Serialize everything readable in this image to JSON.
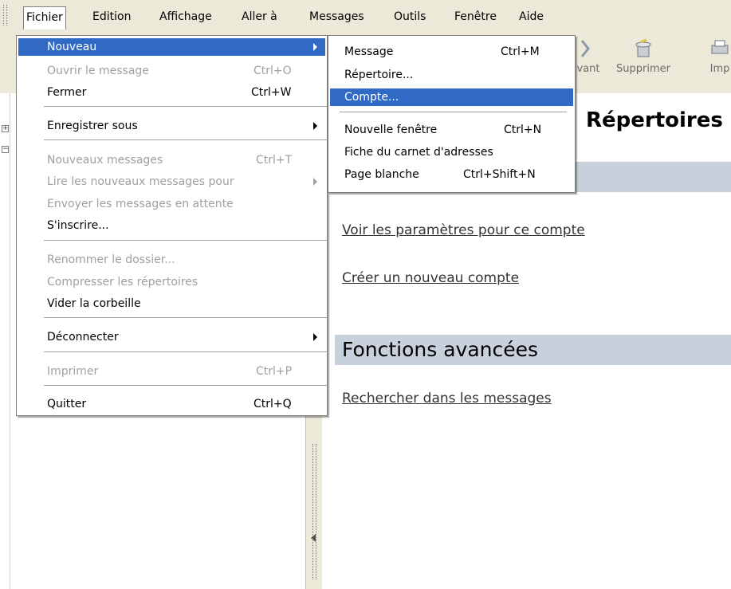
{
  "menubar": {
    "items": [
      "Fichier",
      "Edition",
      "Affichage",
      "Aller à",
      "Messages",
      "Outils",
      "Fenêtre",
      "Aide"
    ]
  },
  "toolbar": {
    "buttons": [
      {
        "label": "vant",
        "icon": "next-icon"
      },
      {
        "label": "Supprimer",
        "icon": "trash-icon"
      },
      {
        "label": "Imp",
        "icon": "print-icon"
      }
    ]
  },
  "fichier_menu": {
    "items": [
      {
        "label": "Nouveau",
        "shortcut": "",
        "submenu": true,
        "disabled": false,
        "highlighted": true
      },
      {
        "label": "Ouvrir le message",
        "shortcut": "Ctrl+O",
        "submenu": false,
        "disabled": true
      },
      {
        "label": "Fermer",
        "shortcut": "Ctrl+W",
        "submenu": false,
        "disabled": false
      },
      {
        "label": "Enregistrer sous",
        "shortcut": "",
        "submenu": true,
        "disabled": false
      },
      {
        "label": "Nouveaux messages",
        "shortcut": "Ctrl+T",
        "submenu": false,
        "disabled": true
      },
      {
        "label": "Lire les nouveaux messages pour",
        "shortcut": "",
        "submenu": true,
        "disabled": true
      },
      {
        "label": "Envoyer les messages en attente",
        "shortcut": "",
        "submenu": false,
        "disabled": true
      },
      {
        "label": "S'inscrire...",
        "shortcut": "",
        "submenu": false,
        "disabled": false
      },
      {
        "label": "Renommer le dossier...",
        "shortcut": "",
        "submenu": false,
        "disabled": true
      },
      {
        "label": "Compresser les répertoires",
        "shortcut": "",
        "submenu": false,
        "disabled": true
      },
      {
        "label": "Vider la corbeille",
        "shortcut": "",
        "submenu": false,
        "disabled": false
      },
      {
        "label": "Déconnecter",
        "shortcut": "",
        "submenu": true,
        "disabled": false
      },
      {
        "label": "Imprimer",
        "shortcut": "Ctrl+P",
        "submenu": false,
        "disabled": true
      },
      {
        "label": "Quitter",
        "shortcut": "Ctrl+Q",
        "submenu": false,
        "disabled": false
      }
    ]
  },
  "nouveau_menu": {
    "items": [
      {
        "label": "Message",
        "shortcut": "Ctrl+M",
        "highlighted": false
      },
      {
        "label": "Répertoire...",
        "shortcut": "",
        "highlighted": false
      },
      {
        "label": "Compte...",
        "shortcut": "",
        "highlighted": true
      },
      {
        "label": "Nouvelle fenêtre",
        "shortcut": "Ctrl+N",
        "highlighted": false
      },
      {
        "label": "Fiche du carnet d'adresses",
        "shortcut": "",
        "highlighted": false
      },
      {
        "label": "Page blanche",
        "shortcut": "Ctrl+Shift+N",
        "highlighted": false
      }
    ]
  },
  "content": {
    "title": "Répertoires",
    "links_account": [
      "Voir les paramètres pour ce compte",
      "Créer un nouveau compte"
    ],
    "advanced_title": "Fonctions avancées",
    "links_advanced": [
      "Rechercher dans les messages"
    ]
  },
  "colors": {
    "highlight": "#316ac5",
    "band": "#c8d0dc",
    "chrome": "#ece9d8"
  }
}
